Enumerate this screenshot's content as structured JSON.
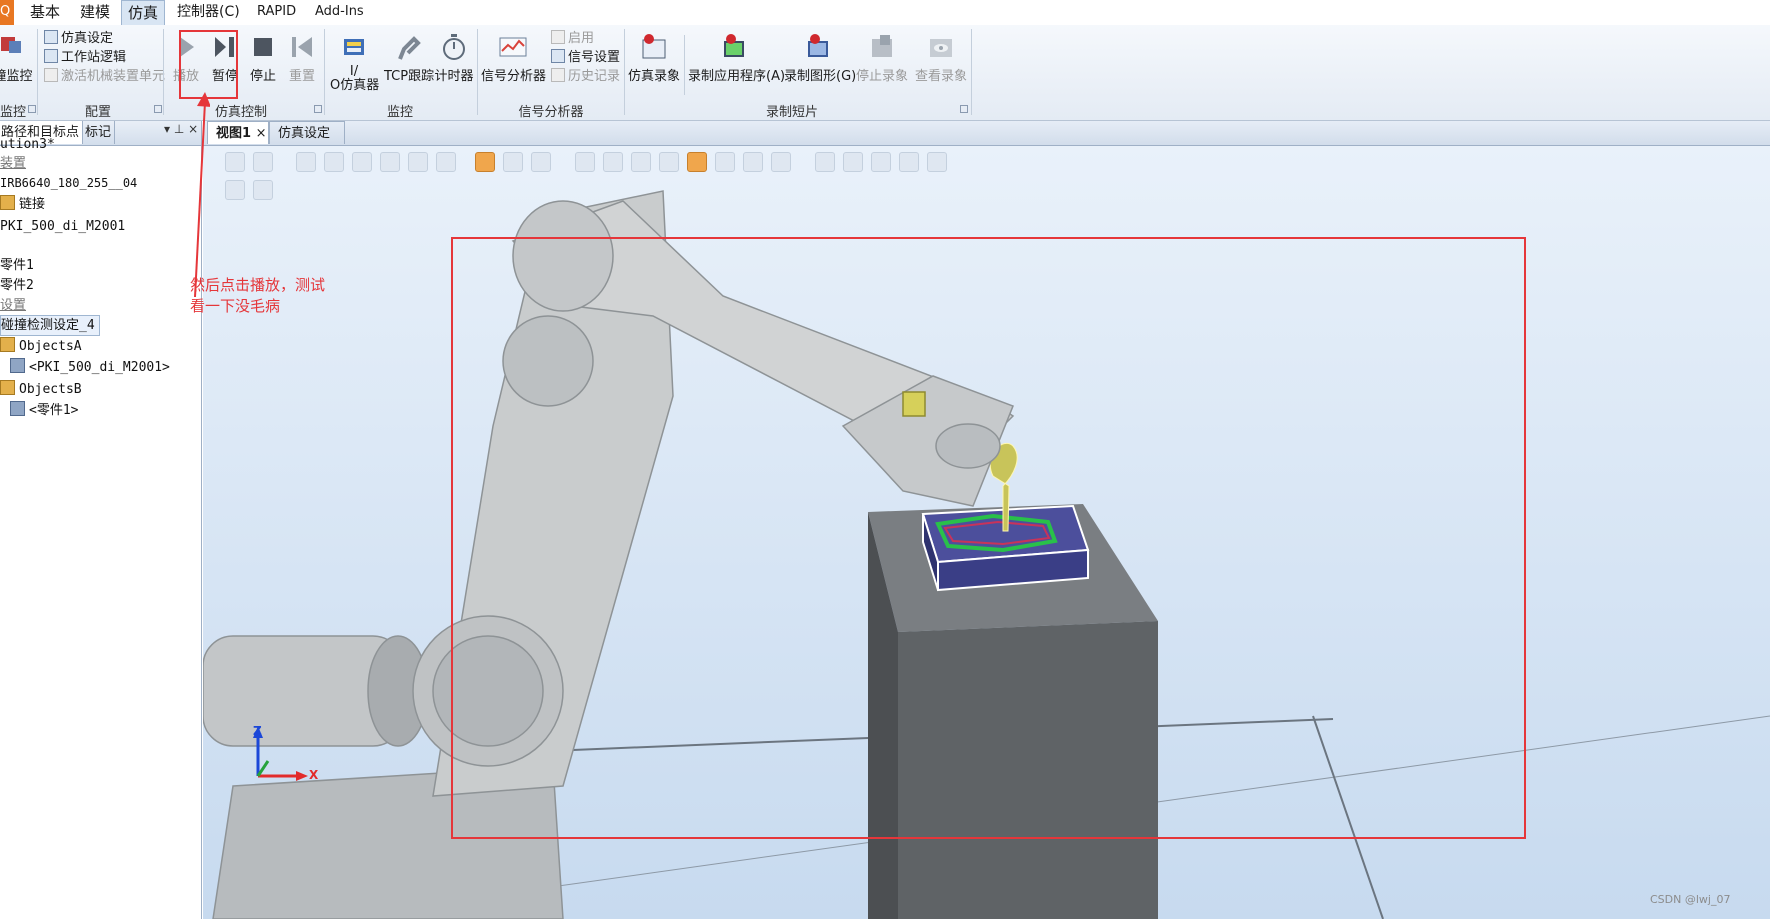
{
  "menu": {
    "file_label": "Q",
    "tabs": [
      "基本",
      "建模",
      "仿真",
      "控制器(C)",
      "RAPID",
      "Add-Ins"
    ],
    "active_tab": "仿真"
  },
  "ribbon": {
    "collision": {
      "label": "撞监控",
      "group": "监控"
    },
    "config": {
      "items": [
        "仿真设定",
        "工作站逻辑",
        "激活机械装置单元"
      ],
      "group": "配置"
    },
    "sim_control": {
      "buttons": [
        "播放",
        "暂停",
        "停止",
        "重置"
      ],
      "group": "仿真控制"
    },
    "monitor": {
      "io_label": "I/\nO仿真器",
      "tcp_label": "TCP跟踪",
      "timer_label": "计时器",
      "group": "监控"
    },
    "signal": {
      "analyzer_label": "信号分析器",
      "enable_label": "启用",
      "settings_label": "信号设置",
      "history_label": "历史记录",
      "group": "信号分析器"
    },
    "record": {
      "buttons": [
        "仿真录象",
        "录制应用程序(A)",
        "录制图形(G)",
        "停止录象",
        "查看录象"
      ],
      "group": "录制短片"
    }
  },
  "left_panel": {
    "tabs": [
      "路径和目标点",
      "标记"
    ],
    "pin": "▾ ⊥ ×",
    "tree": [
      "ution3*",
      "装置",
      "IRB6640_180_255__04",
      "链接",
      "PKI_500_di_M2001",
      "零件1",
      "零件2",
      "设置",
      "碰撞检测设定_4",
      "ObjectsA",
      "<PKI_500_di_M2001>",
      "ObjectsB",
      "<零件1>"
    ]
  },
  "doc_tabs": [
    "视图1",
    "仿真设定"
  ],
  "doc_tab_close": "×",
  "annotation": {
    "line1": "然后点击播放，测试",
    "line2": "看一下没毛病"
  },
  "axes": {
    "z": "Z",
    "x": "X"
  },
  "watermark": "CSDN @lwj_07",
  "colors": {
    "accent": "#e5363a",
    "viewport_top": "#e9f1fa",
    "viewport_bottom": "#c7daef",
    "robot": "#c9cccd",
    "table": "#6a6d70",
    "workpiece": "#4a4f9a",
    "tool": "#c8c45a"
  }
}
